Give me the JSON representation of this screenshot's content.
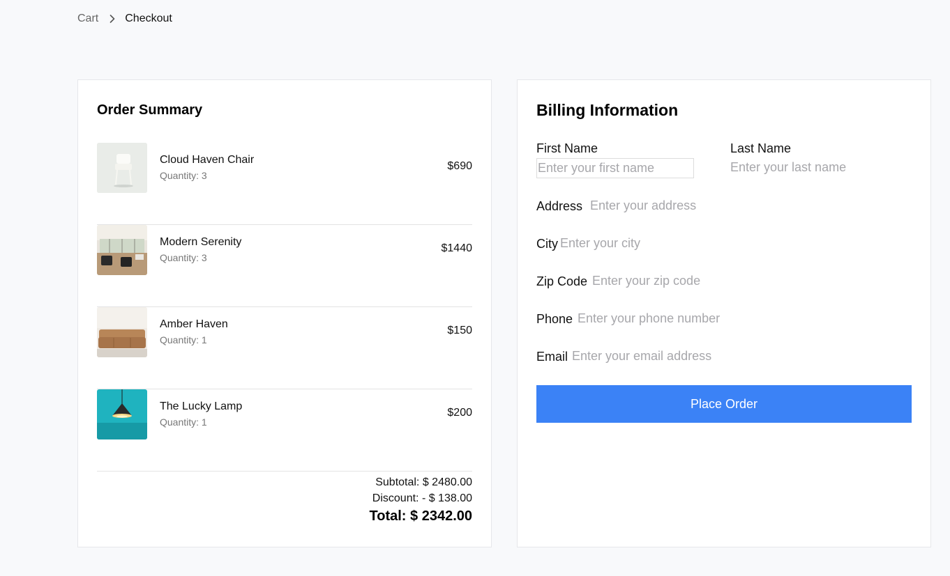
{
  "breadcrumb": {
    "cart": "Cart",
    "current": "Checkout",
    "separator_icon": "chevron-right-icon"
  },
  "summary": {
    "title": "Order Summary",
    "items": [
      {
        "name": "Cloud Haven Chair",
        "quantity": "Quantity: 3",
        "price": "$690",
        "thumb": "white-chair-image"
      },
      {
        "name": "Modern Serenity",
        "quantity": "Quantity: 3",
        "price": "$1440",
        "thumb": "living-room-image"
      },
      {
        "name": "Amber Haven",
        "quantity": "Quantity: 1",
        "price": "$150",
        "thumb": "tan-sofa-image"
      },
      {
        "name": "The Lucky Lamp",
        "quantity": "Quantity: 1",
        "price": "$200",
        "thumb": "pendant-lamp-image"
      }
    ],
    "subtotal": "Subtotal: $ 2480.00",
    "discount": "Discount: - $ 138.00",
    "total": "Total: $ 2342.00"
  },
  "billing": {
    "title": "Billing Information",
    "first_name": {
      "label": "First Name",
      "placeholder": "Enter your first name"
    },
    "last_name": {
      "label": "Last Name",
      "placeholder": "Enter your last name"
    },
    "address": {
      "label": "Address",
      "placeholder": "Enter your address"
    },
    "city": {
      "label": "City",
      "placeholder": "Enter your city"
    },
    "zip": {
      "label": "Zip Code",
      "placeholder": "Enter your zip code"
    },
    "phone": {
      "label": "Phone",
      "placeholder": "Enter your phone number"
    },
    "email": {
      "label": "Email",
      "placeholder": "Enter your email address"
    },
    "submit": "Place Order"
  },
  "colors": {
    "accent": "#3b82f6",
    "background": "#f8f9fb",
    "panel": "#ffffff",
    "placeholder": "#a7a7ab"
  }
}
